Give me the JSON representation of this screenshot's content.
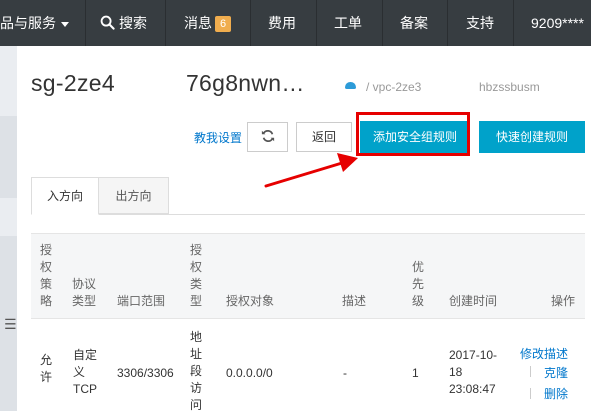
{
  "topnav": {
    "products": "品与服务",
    "search": "搜索",
    "messages": "消息",
    "message_count": "6",
    "billing": "费用",
    "tickets": "工单",
    "filing": "备案",
    "support": "支持",
    "account": "9209****"
  },
  "header": {
    "title": "sg-2ze4",
    "title_end": "76g8nwn…",
    "breadcrumb": "/  vpc-2ze3",
    "breadcrumb_tail": "hbzssbusm"
  },
  "toolbar": {
    "help_link": "教我设置",
    "back": "返回",
    "add_rule": "添加安全组规则",
    "quick_create": "快速创建规则"
  },
  "tabs": [
    "入方向",
    "出方向"
  ],
  "table": {
    "headers": {
      "policy": "授权策略",
      "protocol": "协议类型",
      "port": "端口范围",
      "auth_type": "授权类型",
      "auth_object": "授权对象",
      "description": "描述",
      "priority": "优先级",
      "created": "创建时间",
      "actions": "操作"
    },
    "rows": [
      {
        "policy": "允许",
        "protocol_1": "自定",
        "protocol_2": "义",
        "protocol_3": "TCP",
        "port": "3306/3306",
        "auth_type": "地址段访问",
        "auth_object": "0.0.0.0/0",
        "description": "-",
        "priority": "1",
        "created_1": "2017-10-",
        "created_2": "18",
        "created_3": "23:08:47",
        "action_edit": "修改描述",
        "action_clone": "克隆",
        "action_delete": "删除"
      }
    ]
  },
  "colors": {
    "nav_bg": "#373d41",
    "primary": "#00a2ca",
    "link": "#0077cc",
    "annotation": "#e60000",
    "badge": "#f0ad4e"
  }
}
